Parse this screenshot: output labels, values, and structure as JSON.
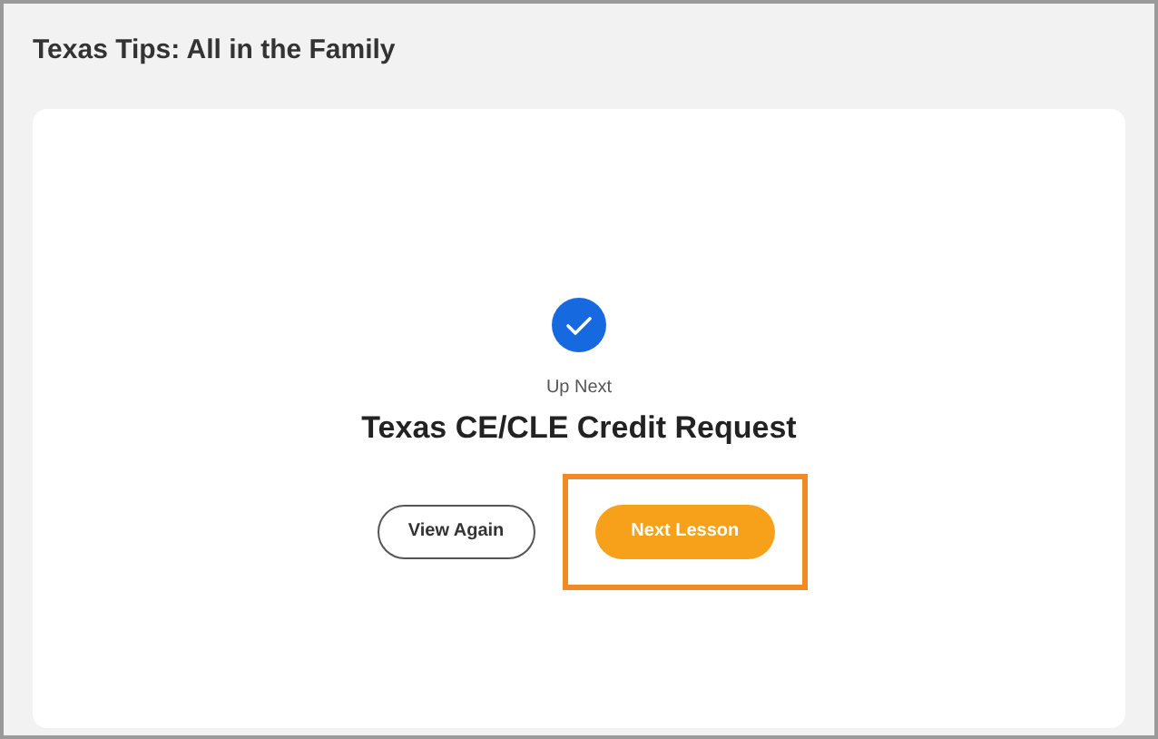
{
  "header": {
    "title": "Texas Tips: All in the Family"
  },
  "card": {
    "done": true,
    "eyebrow": "Up Next",
    "title": "Texas CE/CLE Credit Request",
    "buttons": [
      {
        "label": "View Again",
        "kind": "secondary",
        "highlighted": false
      },
      {
        "label": "Next Lesson",
        "kind": "primary",
        "highlighted": true
      }
    ]
  }
}
